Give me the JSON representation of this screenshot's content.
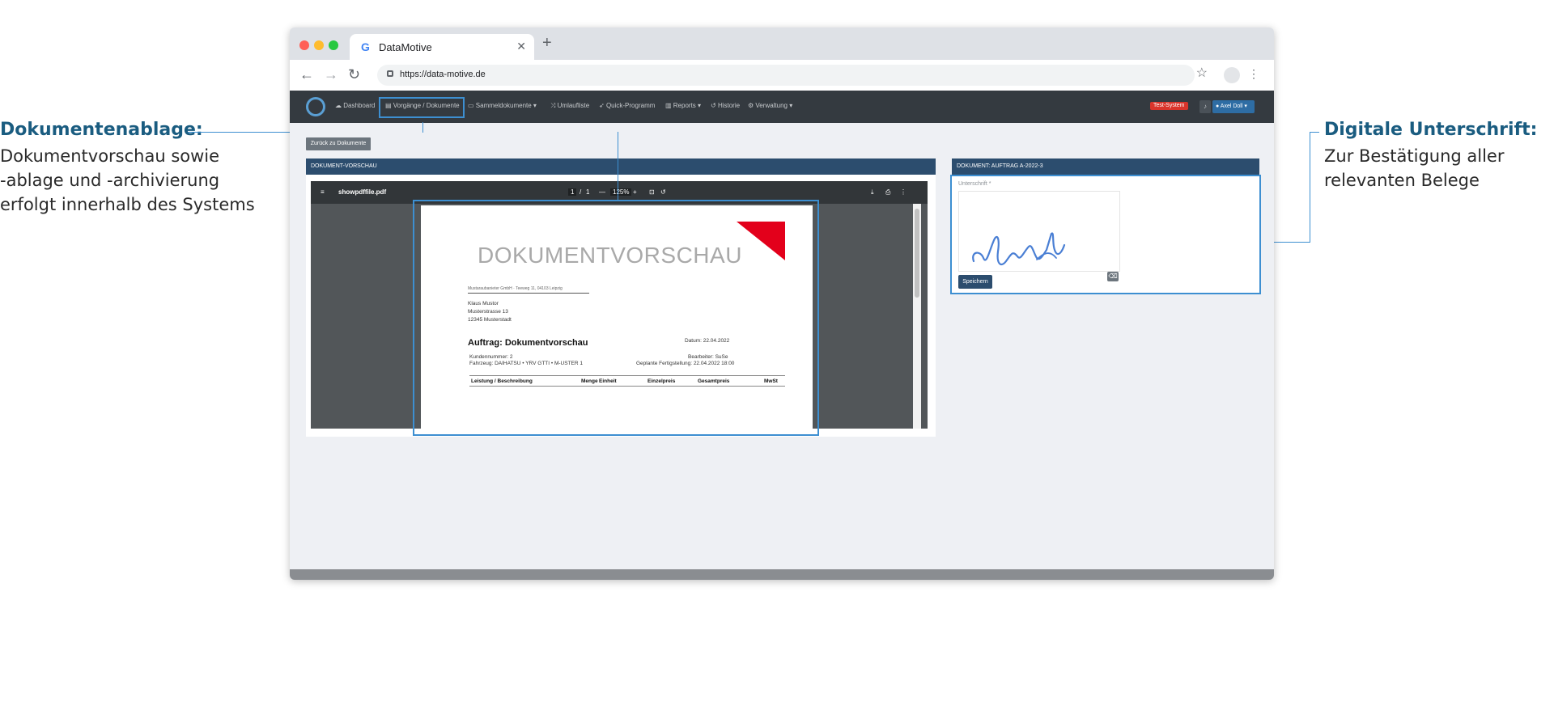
{
  "left_callout": {
    "title": "Dokumentenablage:",
    "lines": [
      "Dokumentvorschau sowie",
      "-ablage und -archivierung",
      "erfolgt innerhalb des Systems"
    ]
  },
  "right_callout": {
    "title": "Digitale Unterschrift:",
    "lines": [
      "Zur Bestätigung aller",
      "relevanten Belege"
    ]
  },
  "browser": {
    "tab_title": "DataMotive",
    "url": "https://data-motive.de"
  },
  "navbar": {
    "items": [
      {
        "label": "Dashboard",
        "icon": "tachometer-icon"
      },
      {
        "label": "Vorgänge / Dokumente",
        "icon": "file-icon"
      },
      {
        "label": "Sammeldokumente",
        "icon": "folder-icon"
      },
      {
        "label": "Umlaufliste",
        "icon": "shuffle-icon"
      },
      {
        "label": "Quick-Programm",
        "icon": "rocket-icon"
      },
      {
        "label": "Reports",
        "icon": "chart-icon"
      },
      {
        "label": "Historie",
        "icon": "history-icon"
      },
      {
        "label": "Verwaltung",
        "icon": "gears-icon"
      }
    ],
    "badge": "Test-System",
    "user": "Axel Doll"
  },
  "content": {
    "back_button": "Zurück zu Dokumente",
    "left_panel_title": "DOKUMENT-VORSCHAU",
    "right_panel_title": "DOKUMENT: AUFTRAG A-2022-3"
  },
  "pdf_viewer": {
    "filename": "showpdffile.pdf",
    "page_current": "1",
    "page_sep": "/",
    "page_total": "1",
    "zoom": "125%"
  },
  "pdf": {
    "title": "DOKUMENTVORSCHAU",
    "sender_line": "Mustaraubanieter GmbH · Teeweg 11, 04103 Leipzig",
    "recipient": [
      "Klaus Mustor",
      "Musterstrasse 13",
      "12345 Musterstadt"
    ],
    "heading": "Auftrag: Dokumentvorschau",
    "date": "Datum: 22.04.2022",
    "customer_no": "Kundennummer: 2",
    "vehicle": "Fahrzeug: DAIHATSU • YRV GTTI • M-USTER 1",
    "editor": "Bearbeiter: SuSe",
    "planned": "Geplante Fertigstellung: 22.04.2022 18:00",
    "table_headers": [
      "Leistung / Beschreibung",
      "Menge",
      "Einheit",
      "Einzelpreis",
      "Gesamtpreis",
      "MwSt"
    ]
  },
  "signature": {
    "label": "Unterschrift *",
    "save_label": "Speichern"
  }
}
